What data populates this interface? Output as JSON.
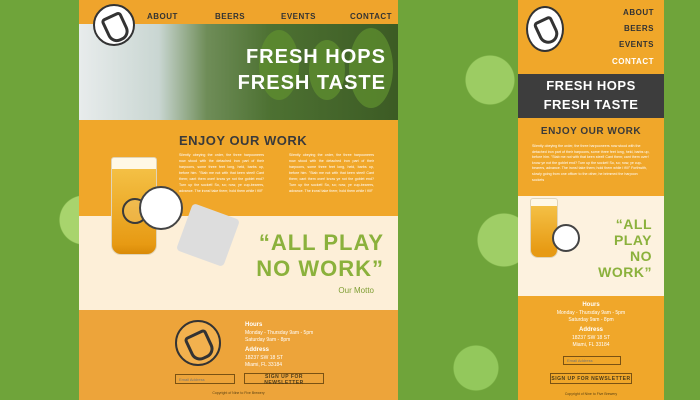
{
  "colors": {
    "accent": "#F0A72A",
    "hero_band": "#3D3D3D",
    "motto": "#8BB13C",
    "hop_green": "#6FA43A"
  },
  "icons": {
    "brand_logo": "brewery-emblem-icon",
    "glass": "beer-glass-icon",
    "coaster": "coaster-icon"
  },
  "nav": {
    "items": [
      "ABOUT",
      "BEERS",
      "EVENTS",
      "CONTACT"
    ]
  },
  "hero": {
    "line1": "FRESH HOPS",
    "line2": "FRESH TASTE"
  },
  "section": {
    "title": "ENJOY OUR WORK",
    "paragraph1": "Silently obeying the order, the three harpooneers now stood with the detached iron part of their harpoons, some three feet long, held, barbs up, before him. \"Stab me not with that keen steel! Cant them; cant them over! know ye not the goblet end? Turn up the socket! So, so; now, ye cup-bearers, advance. The irons! take them; hold them while I fill!\"",
    "paragraph2": "Silently obeying the order, the three harpooneers now stood with the detached iron part of their harpoons, some three feet long, held, barbs up, before him. \"Stab me not with that keen steel! Cant them; cant them over! know ye not the goblet end? Turn up the socket! So, so; now, ye cup-bearers, advance. The irons! take them; hold them while I fill!\"",
    "mobile_paragraph": "Silently obeying the order, the three harpooneers now stood with the detached iron part of their harpoons, some three feet long, held, barbs up, before him. \"Stab me not with that keen steel! Cant them; cant them over! know ye not the goblet end? Turn up the socket! So, so; now, ye cup-bearers, advance. The irons! take them; hold them while I fill!\" Forthwith, slowly going from one officer to the other, he brimmed the harpoon sockets"
  },
  "motto": {
    "line1": "“ALL PLAY",
    "line2": "NO WORK”",
    "mobile_line1": "“ALL",
    "mobile_line2": "PLAY",
    "mobile_line3": "NO",
    "mobile_line4": "WORK”",
    "caption": "Our Motto"
  },
  "footer": {
    "hours_label": "Hours",
    "hours_line1": "Monday - Thursday 9am - 5pm",
    "hours_line2": "Saturday 9am - 8pm",
    "address_label": "Address",
    "address_line1": "18237 SW 18 ST",
    "address_line2": "Miami, FL 33184",
    "email_placeholder": "Email Address",
    "signup_label": "SIGN UP FOR NEWSLETTER",
    "copyright": "Copyright of Nine to Five Brewery"
  }
}
